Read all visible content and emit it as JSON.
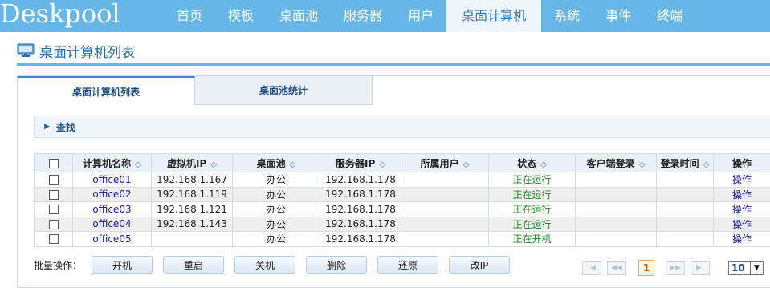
{
  "app": {
    "logo": "Deskpool"
  },
  "nav": {
    "items": [
      "首页",
      "模板",
      "桌面池",
      "服务器",
      "用户",
      "桌面计算机",
      "系统",
      "事件",
      "终端"
    ],
    "active_index": 5
  },
  "page": {
    "title": "桌面计算机列表"
  },
  "tabs": [
    "桌面计算机列表",
    "桌面池统计"
  ],
  "search": {
    "label": "查找"
  },
  "table": {
    "columns": [
      "计算机名称",
      "虚拟机IP",
      "桌面池",
      "服务器IP",
      "所属用户",
      "状态",
      "客户端登录",
      "登录时间",
      "操作"
    ],
    "rows": [
      {
        "name": "office01",
        "vm_ip": "192.168.1.167",
        "pool": "办公",
        "server_ip": "192.168.1.178",
        "user": "",
        "status": "正在运行",
        "client_login": "",
        "login_time": "",
        "action": "操作"
      },
      {
        "name": "office02",
        "vm_ip": "192.168.1.119",
        "pool": "办公",
        "server_ip": "192.168.1.178",
        "user": "",
        "status": "正在运行",
        "client_login": "",
        "login_time": "",
        "action": "操作"
      },
      {
        "name": "office03",
        "vm_ip": "192.168.1.121",
        "pool": "办公",
        "server_ip": "192.168.1.178",
        "user": "",
        "status": "正在运行",
        "client_login": "",
        "login_time": "",
        "action": "操作"
      },
      {
        "name": "office04",
        "vm_ip": "192.168.1.143",
        "pool": "办公",
        "server_ip": "192.168.1.178",
        "user": "",
        "status": "正在运行",
        "client_login": "",
        "login_time": "",
        "action": "操作"
      },
      {
        "name": "office05",
        "vm_ip": "",
        "pool": "办公",
        "server_ip": "192.168.1.178",
        "user": "",
        "status": "正在开机",
        "client_login": "",
        "login_time": "",
        "action": "操作"
      }
    ]
  },
  "bulk": {
    "label": "批量操作：",
    "buttons": [
      "开机",
      "重启",
      "关机",
      "删除",
      "还原",
      "改IP"
    ]
  },
  "pager": {
    "current_page": "1",
    "page_size": "10"
  },
  "colors": {
    "nav_bg": "#66b6e8",
    "accent": "#1f6fb3",
    "status_running": "#1a8a1a",
    "link": "#1a1aa6"
  }
}
